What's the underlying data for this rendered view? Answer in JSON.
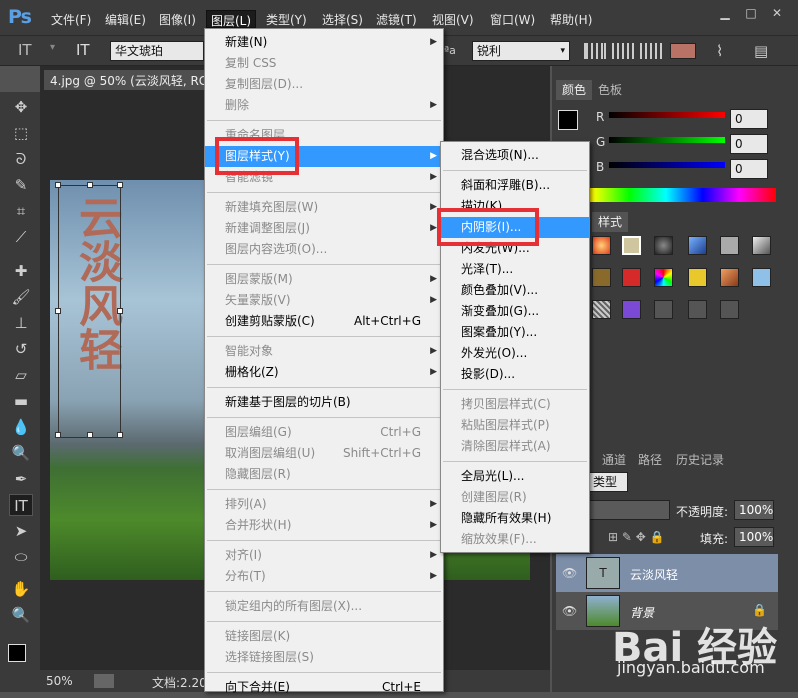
{
  "app": {
    "logo": "Ps"
  },
  "menubar": {
    "items": [
      "文件(F)",
      "编辑(E)",
      "图像(I)",
      "图层(L)",
      "类型(Y)",
      "选择(S)",
      "滤镜(T)",
      "视图(V)",
      "窗口(W)",
      "帮助(H)"
    ],
    "window_controls": [
      "▁",
      "□",
      "✕"
    ]
  },
  "options": {
    "font": "华文琥珀",
    "aa": "ªa",
    "antialias": "锐利"
  },
  "document": {
    "tab": "4.jpg @ 50% (云淡风轻, RGB/8)",
    "text_layer": "云淡风轻",
    "zoom": "50%",
    "doc_info": "文档:2.20"
  },
  "color_panel": {
    "tabs": [
      "颜色",
      "色板"
    ],
    "channels": [
      {
        "name": "R",
        "value": "0"
      },
      {
        "name": "G",
        "value": "0"
      },
      {
        "name": "B",
        "value": "0"
      }
    ]
  },
  "styles_panel": {
    "tabs": [
      "样式"
    ]
  },
  "layers_panel": {
    "tabs": [
      "通道",
      "路径",
      "历史记录"
    ],
    "kind": "类型",
    "opacity_label": "不透明度:",
    "opacity": "100%",
    "fill_label": "填充:",
    "fill": "100%",
    "layers": [
      {
        "name": "云淡风轻",
        "thumb": "T"
      },
      {
        "name": "背景"
      }
    ]
  },
  "layer_menu": {
    "items": [
      {
        "label": "新建(N)",
        "sub": true
      },
      {
        "label": "复制 CSS",
        "dis": true
      },
      {
        "label": "复制图层(D)...",
        "dis": true
      },
      {
        "label": "删除",
        "dis": true,
        "sub": true
      },
      {
        "label": "重命名图层...",
        "dis": true
      },
      {
        "label": "图层样式(Y)",
        "sub": true,
        "hl": true
      },
      {
        "label": "智能滤镜",
        "dis": true,
        "sub": true
      },
      {
        "label": "新建填充图层(W)",
        "dis": true,
        "sub": true
      },
      {
        "label": "新建调整图层(J)",
        "dis": true,
        "sub": true
      },
      {
        "label": "图层内容选项(O)...",
        "dis": true
      },
      {
        "label": "图层蒙版(M)",
        "dis": true,
        "sub": true
      },
      {
        "label": "矢量蒙版(V)",
        "dis": true,
        "sub": true
      },
      {
        "label": "创建剪贴蒙版(C)",
        "sc": "Alt+Ctrl+G"
      },
      {
        "label": "智能对象",
        "dis": true,
        "sub": true
      },
      {
        "label": "栅格化(Z)",
        "sub": true
      },
      {
        "label": "新建基于图层的切片(B)"
      },
      {
        "label": "图层编组(G)",
        "dis": true,
        "sc": "Ctrl+G"
      },
      {
        "label": "取消图层编组(U)",
        "dis": true,
        "sc": "Shift+Ctrl+G"
      },
      {
        "label": "隐藏图层(R)",
        "dis": true
      },
      {
        "label": "排列(A)",
        "dis": true,
        "sub": true
      },
      {
        "label": "合并形状(H)",
        "dis": true,
        "sub": true
      },
      {
        "label": "对齐(I)",
        "dis": true,
        "sub": true
      },
      {
        "label": "分布(T)",
        "dis": true,
        "sub": true
      },
      {
        "label": "锁定组内的所有图层(X)...",
        "dis": true
      },
      {
        "label": "链接图层(K)",
        "dis": true
      },
      {
        "label": "选择链接图层(S)",
        "dis": true
      },
      {
        "label": "向下合并(E)",
        "sc": "Ctrl+E"
      }
    ]
  },
  "style_menu": {
    "items": [
      {
        "label": "混合选项(N)..."
      },
      {
        "label": "斜面和浮雕(B)..."
      },
      {
        "label": "描边(K)..."
      },
      {
        "label": "内阴影(I)...",
        "hl": true
      },
      {
        "label": "内发光(W)..."
      },
      {
        "label": "光泽(T)..."
      },
      {
        "label": "颜色叠加(V)..."
      },
      {
        "label": "渐变叠加(G)..."
      },
      {
        "label": "图案叠加(Y)..."
      },
      {
        "label": "外发光(O)..."
      },
      {
        "label": "投影(D)..."
      },
      {
        "label": "拷贝图层样式(C)",
        "dis": true
      },
      {
        "label": "粘贴图层样式(P)",
        "dis": true
      },
      {
        "label": "清除图层样式(A)",
        "dis": true
      },
      {
        "label": "全局光(L)..."
      },
      {
        "label": "创建图层(R)",
        "dis": true
      },
      {
        "label": "隐藏所有效果(H)"
      },
      {
        "label": "缩放效果(F)...",
        "dis": true
      }
    ]
  },
  "watermark": {
    "brand": "Bai 经验",
    "url": "jingyan.baidu.com"
  }
}
